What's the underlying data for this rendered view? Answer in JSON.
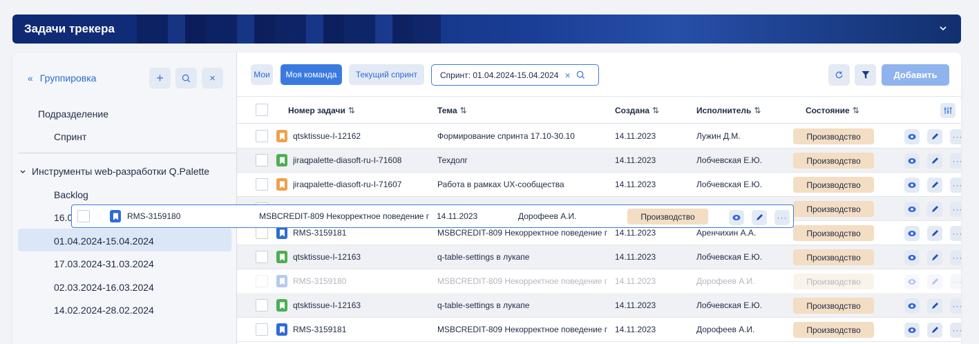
{
  "header": {
    "title": "Задачи трекера"
  },
  "sidebar": {
    "group_label": "Группировка",
    "items": [
      {
        "label": "Подразделение"
      },
      {
        "label": "Спринт"
      },
      {
        "label": "Инструменты web-разработки Q.Palette"
      },
      {
        "label": "Backlog"
      },
      {
        "label": "16.0"
      },
      {
        "label": "01.04.2024-15.04.2024"
      },
      {
        "label": "17.03.2024-31.03.2024"
      },
      {
        "label": "02.03.2024-16.03.2024"
      },
      {
        "label": "14.02.2024-28.02.2024"
      }
    ]
  },
  "toolbar": {
    "tab_mine": "Мои",
    "tab_team": "Моя команда",
    "tab_sprint": "Текущий спринт",
    "filter_value": "Спринт: 01.04.2024-15.04.2024",
    "add_label": "Добавить"
  },
  "table": {
    "columns": [
      "Номер задачи",
      "Тема",
      "Создана",
      "Исполнитель",
      "Состояние"
    ],
    "sort_glyph": "⇅",
    "rows": [
      {
        "id": "qtsktissue-I-12162",
        "topic": "Формирование спринта 17.10-30.10",
        "created": "14.11.2023",
        "assignee": "Лужин Д.М.",
        "status": "Производство",
        "type": "orange"
      },
      {
        "id": "jiraqpalette-diasoft-ru-I-71608",
        "topic": "Техдолг",
        "created": "14.11.2023",
        "assignee": "Лобчевская Е.Ю.",
        "status": "Производство",
        "type": "green"
      },
      {
        "id": "jiraqpalette-diasoft-ru-I-71607",
        "topic": "Работа в рамках UX-сообщества",
        "created": "14.11.2023",
        "assignee": "Лобчевская Е.Ю.",
        "status": "Производство",
        "type": "orange"
      },
      {
        "id": "",
        "topic": "",
        "created": "",
        "assignee": "",
        "status": "Производство",
        "type": "none"
      },
      {
        "id": "RMS-3159181",
        "topic": "MSBCREDIT-809 Некорректное поведение г",
        "created": "14.11.2023",
        "assignee": "Аренчихин А.А.",
        "status": "Производство",
        "type": "blue"
      },
      {
        "id": "qtsktissue-I-12163",
        "topic": "q-table-settings в лукапе",
        "created": "14.11.2023",
        "assignee": "Лобчевская Е.Ю.",
        "status": "Производство",
        "type": "green"
      },
      {
        "id": "RMS-3159180",
        "topic": "MSBCREDIT-809 Некорректное поведение г",
        "created": "14.11.2023",
        "assignee": "Дорофеев А.И.",
        "status": "Производство",
        "type": "blue"
      },
      {
        "id": "qtsktissue-I-12163",
        "topic": "q-table-settings в лукапе",
        "created": "14.11.2023",
        "assignee": "Лобчевская Е.Ю.",
        "status": "Производство",
        "type": "green"
      },
      {
        "id": "RMS-3159181",
        "topic": "MSBCREDIT-809 Некорректное поведение г",
        "created": "14.11.2023",
        "assignee": "Дорофеев А.И.",
        "status": "Производство",
        "type": "blue"
      }
    ]
  },
  "drag_row": {
    "id": "RMS-3159180",
    "topic": "MSBCREDIT-809 Некорректное поведение г",
    "created": "14.11.2023",
    "assignee": "Дорофеев А.И.",
    "status": "Производство",
    "type": "blue"
  },
  "colors": {
    "accent": "#3a7ae0",
    "orange": "#f0a04b",
    "green": "#4caf50",
    "blue": "#2f6ad8",
    "status_bg": "#f3ddc3"
  }
}
